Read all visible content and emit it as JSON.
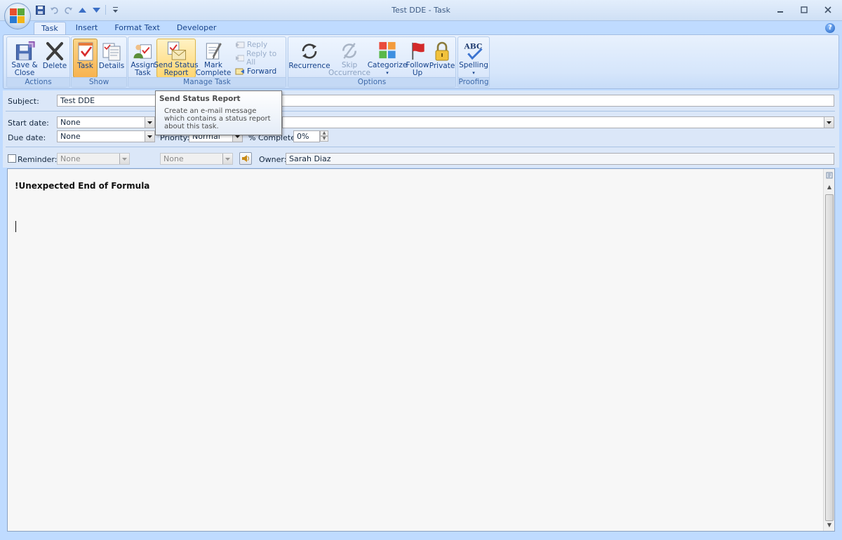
{
  "window": {
    "title": "Test DDE - Task"
  },
  "tabs": [
    "Task",
    "Insert",
    "Format Text",
    "Developer"
  ],
  "ribbon": {
    "actions": {
      "label": "Actions",
      "save_close": "Save &\nClose",
      "delete": "Delete"
    },
    "show": {
      "label": "Show",
      "task": "Task",
      "details": "Details"
    },
    "manage_task": {
      "label": "Manage Task",
      "assign_task": "Assign\nTask",
      "send_status_report": "Send Status\nReport",
      "mark_complete": "Mark\nComplete",
      "reply": "Reply",
      "reply_all": "Reply to All",
      "forward": "Forward"
    },
    "options": {
      "label": "Options",
      "recurrence": "Recurrence",
      "skip_occurrence": "Skip\nOccurrence",
      "categorize": "Categorize",
      "follow_up": "Follow\nUp",
      "private": "Private"
    },
    "proofing": {
      "label": "Proofing",
      "spelling": "Spelling",
      "abc": "ABC"
    }
  },
  "tooltip": {
    "title": "Send Status Report",
    "body": "Create an e-mail message which contains a status report about this task."
  },
  "form": {
    "subject_label": "Subject:",
    "subject_value": "Test DDE",
    "start_date_label": "Start date:",
    "start_date_value": "None",
    "due_date_label": "Due date:",
    "due_date_value": "None",
    "priority_label": "Priority:",
    "priority_value": "Normal",
    "percent_label": "% Complete:",
    "percent_value": "0%",
    "reminder_label": "Reminder:",
    "reminder_date": "None",
    "reminder_time": "None",
    "owner_label": "Owner:",
    "owner_value": "Sarah Diaz"
  },
  "editor": {
    "text": "!Unexpected End of Formula"
  }
}
